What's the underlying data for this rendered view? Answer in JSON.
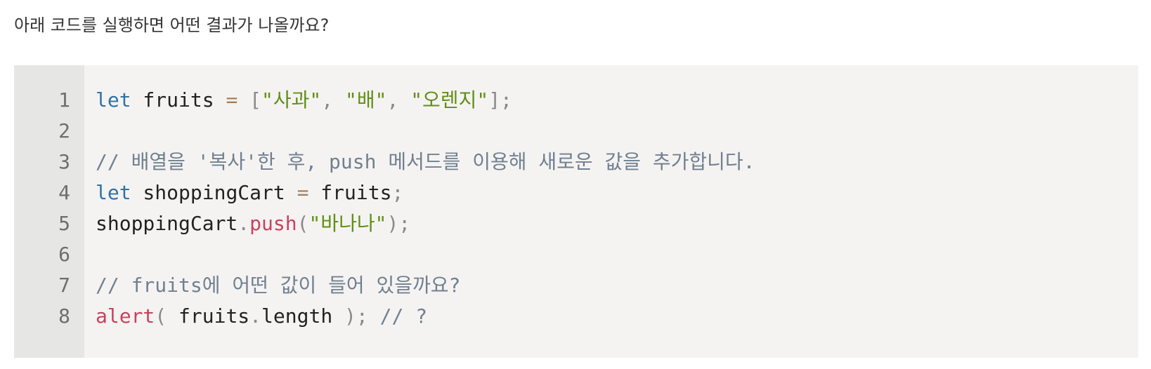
{
  "question": "아래 코드를 실행하면 어떤 결과가 나올까요?",
  "colors": {
    "keyword": "#2f73a6",
    "string": "#5f8f16",
    "comment": "#708090",
    "function": "#c8415d",
    "operator": "#a67f59",
    "background": "#f5f3f2",
    "gutter": "#e6e6e5"
  },
  "code": {
    "line_numbers": [
      "1",
      "2",
      "3",
      "4",
      "5",
      "6",
      "7",
      "8"
    ],
    "lines": [
      {
        "tokens": [
          {
            "type": "keyword",
            "text": "let"
          },
          {
            "type": "plain",
            "text": " fruits "
          },
          {
            "type": "op",
            "text": "="
          },
          {
            "type": "plain",
            "text": " "
          },
          {
            "type": "punc",
            "text": "["
          },
          {
            "type": "string",
            "text": "\"사과\""
          },
          {
            "type": "punc",
            "text": ","
          },
          {
            "type": "plain",
            "text": " "
          },
          {
            "type": "string",
            "text": "\"배\""
          },
          {
            "type": "punc",
            "text": ","
          },
          {
            "type": "plain",
            "text": " "
          },
          {
            "type": "string",
            "text": "\"오렌지\""
          },
          {
            "type": "punc",
            "text": "];"
          }
        ]
      },
      {
        "tokens": []
      },
      {
        "tokens": [
          {
            "type": "comment",
            "text": "// 배열을 '복사'한 후, push 메서드를 이용해 새로운 값을 추가합니다."
          }
        ]
      },
      {
        "tokens": [
          {
            "type": "keyword",
            "text": "let"
          },
          {
            "type": "plain",
            "text": " shoppingCart "
          },
          {
            "type": "op",
            "text": "="
          },
          {
            "type": "plain",
            "text": " fruits"
          },
          {
            "type": "punc",
            "text": ";"
          }
        ]
      },
      {
        "tokens": [
          {
            "type": "plain",
            "text": "shoppingCart"
          },
          {
            "type": "punc",
            "text": "."
          },
          {
            "type": "func",
            "text": "push"
          },
          {
            "type": "punc",
            "text": "("
          },
          {
            "type": "string",
            "text": "\"바나나\""
          },
          {
            "type": "punc",
            "text": ");"
          }
        ]
      },
      {
        "tokens": []
      },
      {
        "tokens": [
          {
            "type": "comment",
            "text": "// fruits에 어떤 값이 들어 있을까요?"
          }
        ]
      },
      {
        "tokens": [
          {
            "type": "func",
            "text": "alert"
          },
          {
            "type": "punc",
            "text": "("
          },
          {
            "type": "plain",
            "text": " fruits"
          },
          {
            "type": "punc",
            "text": "."
          },
          {
            "type": "plain",
            "text": "length "
          },
          {
            "type": "punc",
            "text": ");"
          },
          {
            "type": "plain",
            "text": " "
          },
          {
            "type": "comment",
            "text": "// ?"
          }
        ]
      }
    ]
  }
}
